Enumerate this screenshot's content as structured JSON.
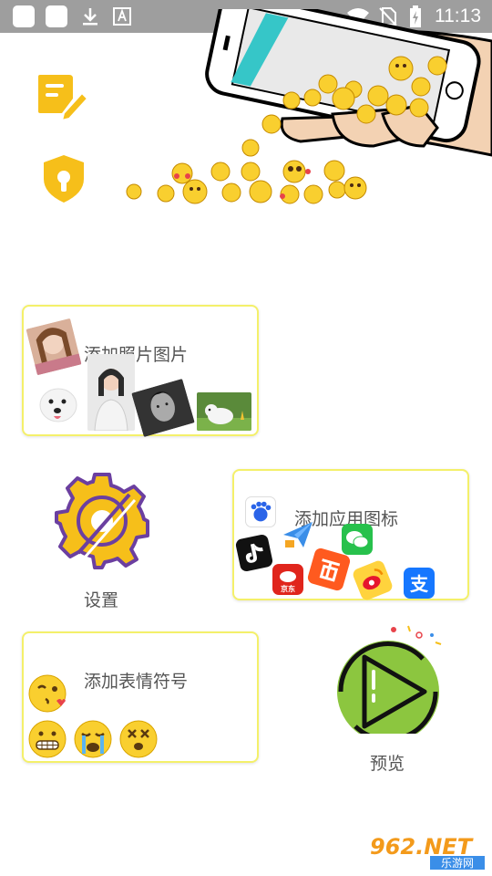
{
  "status_bar": {
    "time": "11:13"
  },
  "cards": {
    "photos": {
      "label": "添加照片图片"
    },
    "apps": {
      "label": "添加应用图标",
      "icons": {
        "jd": "京东",
        "alipay": "支"
      }
    },
    "emoji": {
      "label": "添加表情符号"
    }
  },
  "settings": {
    "label": "设置"
  },
  "preview": {
    "label": "预览"
  },
  "watermark": {
    "main": "962.NET",
    "sub": "乐游网"
  },
  "colors": {
    "accent_yellow": "#f6bf1a",
    "card_border": "#f4f06a",
    "gear_purple": "#6b3fa0",
    "play_green": "#8cc63f"
  },
  "icons": [
    "edit-note-icon",
    "shield-lock-icon",
    "gear-icon",
    "play-icon"
  ]
}
